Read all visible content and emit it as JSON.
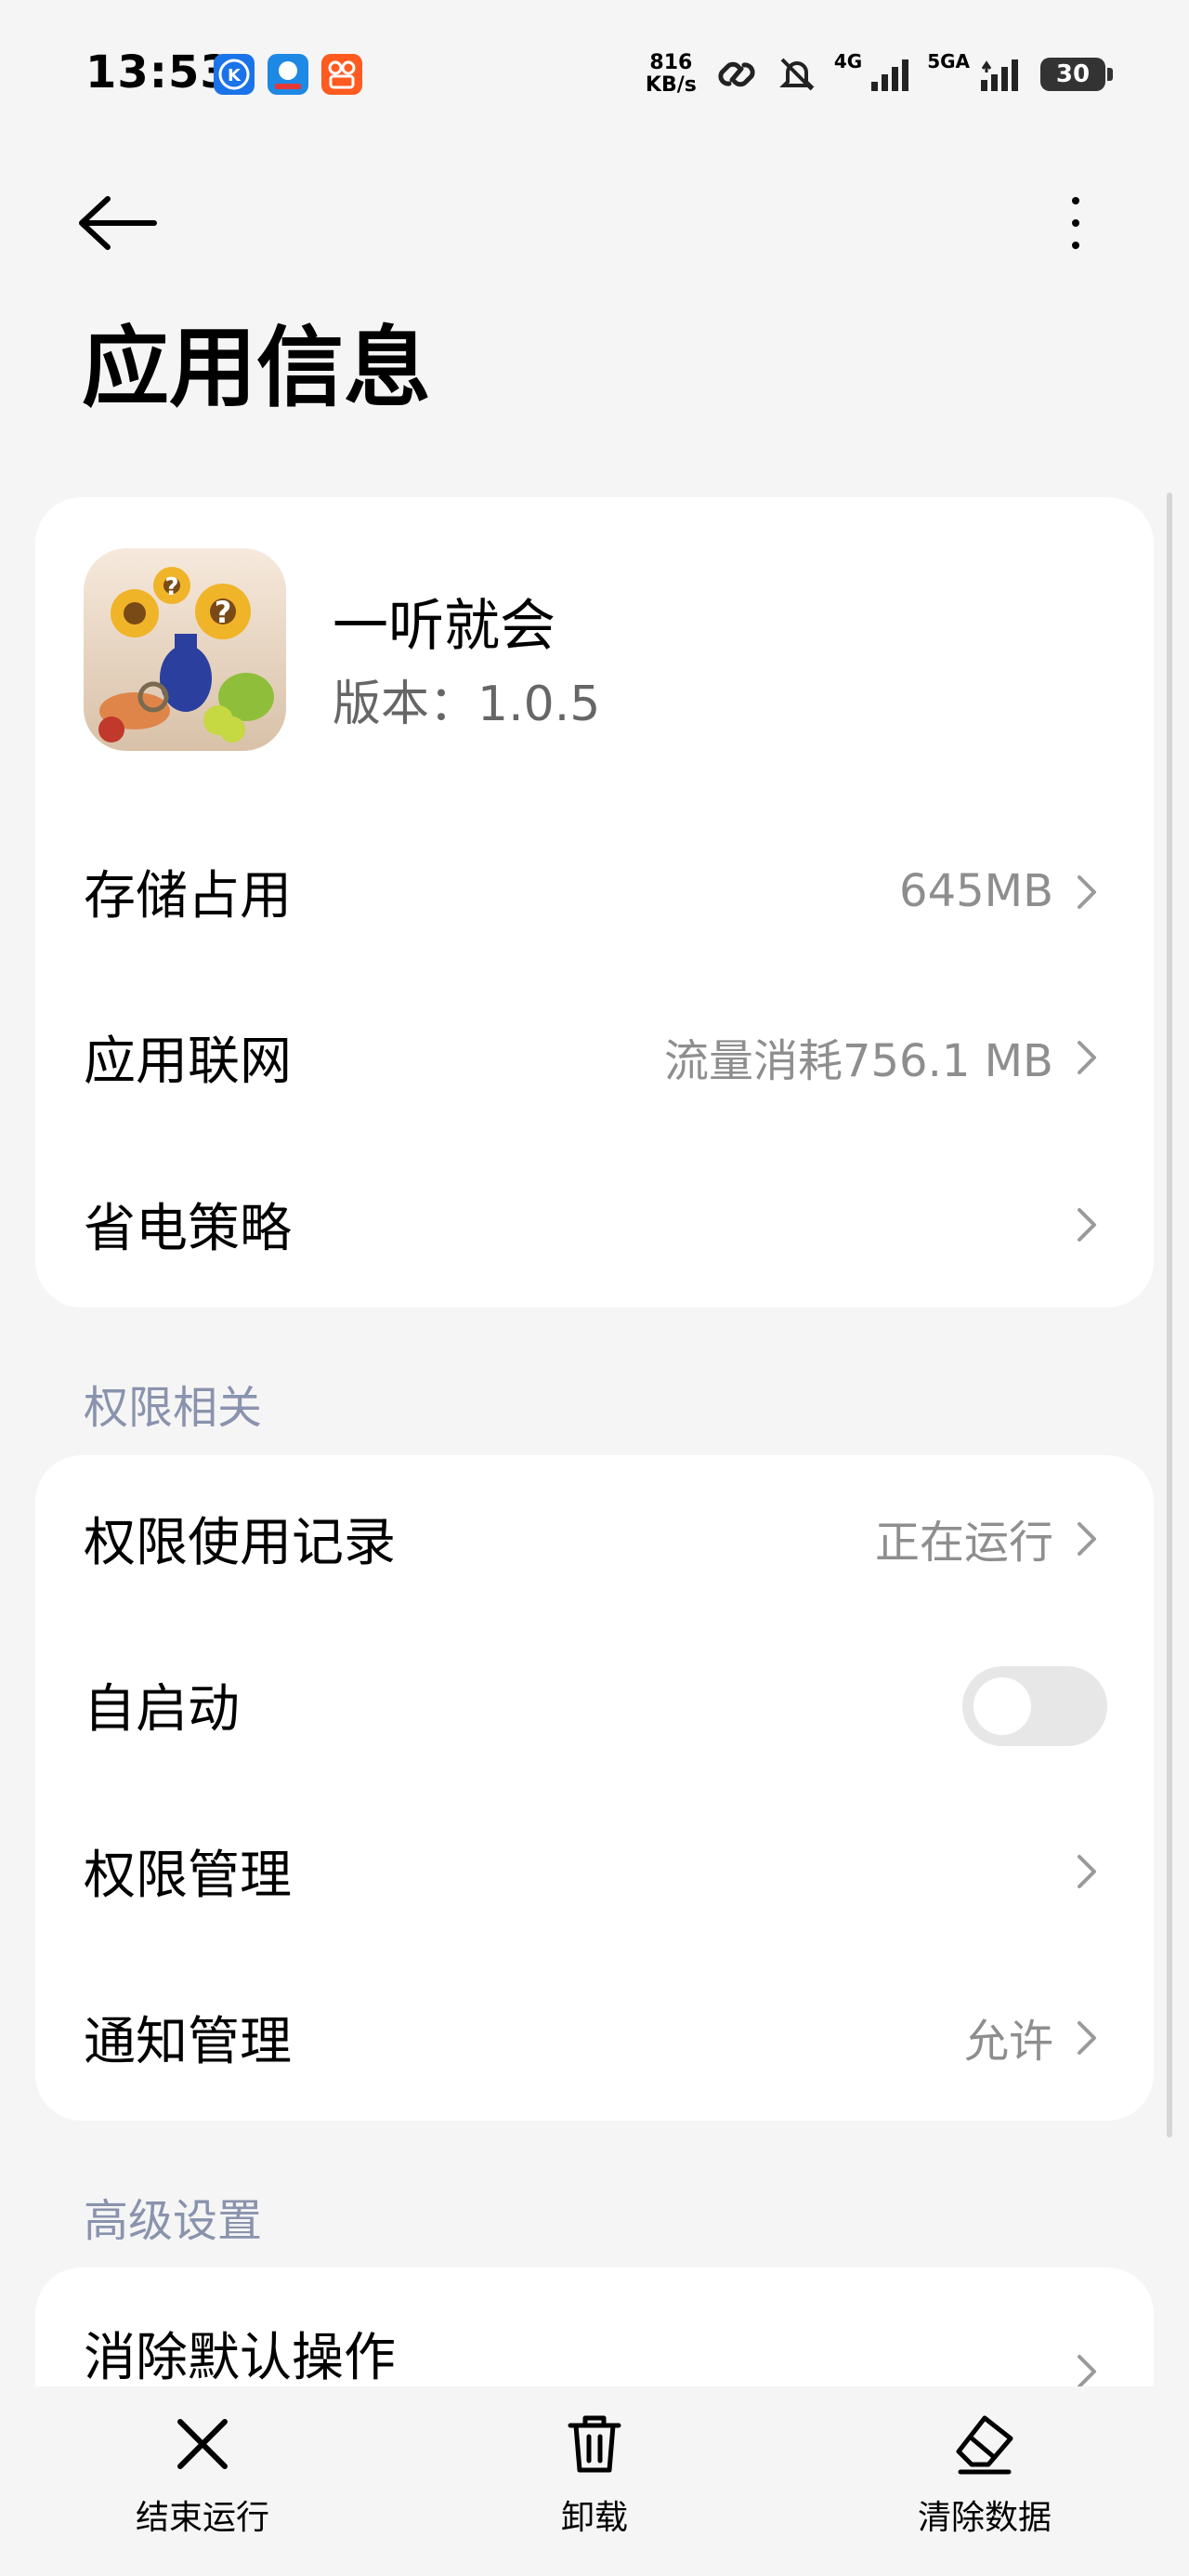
{
  "status_bar": {
    "time": "13:53",
    "net_speed_value": "816",
    "net_speed_unit": "KB/s",
    "signal1_label": "4G",
    "signal2_label": "5GA",
    "battery": "30"
  },
  "page": {
    "title": "应用信息"
  },
  "app": {
    "name": "一听就会",
    "version": "版本：1.0.5"
  },
  "main_card": {
    "rows": [
      {
        "label": "存储占用",
        "value": "645MB"
      },
      {
        "label": "应用联网",
        "value": "流量消耗756.1 MB"
      },
      {
        "label": "省电策略",
        "value": ""
      }
    ]
  },
  "permissions": {
    "section_title": "权限相关",
    "rows": [
      {
        "label": "权限使用记录",
        "value": "正在运行"
      },
      {
        "label": "自启动",
        "toggle_on": false
      },
      {
        "label": "权限管理",
        "value": ""
      },
      {
        "label": "通知管理",
        "value": "允许"
      }
    ]
  },
  "advanced": {
    "section_title": "高级设置",
    "rows": [
      {
        "label": "消除默认操作"
      }
    ]
  },
  "bottom_bar": {
    "stop_label": "结束运行",
    "uninstall_label": "卸载",
    "clear_label": "清除数据"
  },
  "colors": {
    "background": "#f5f5f5",
    "card": "#ffffff",
    "section_title": "#8a93ad",
    "secondary_text": "#8e8e8e"
  }
}
